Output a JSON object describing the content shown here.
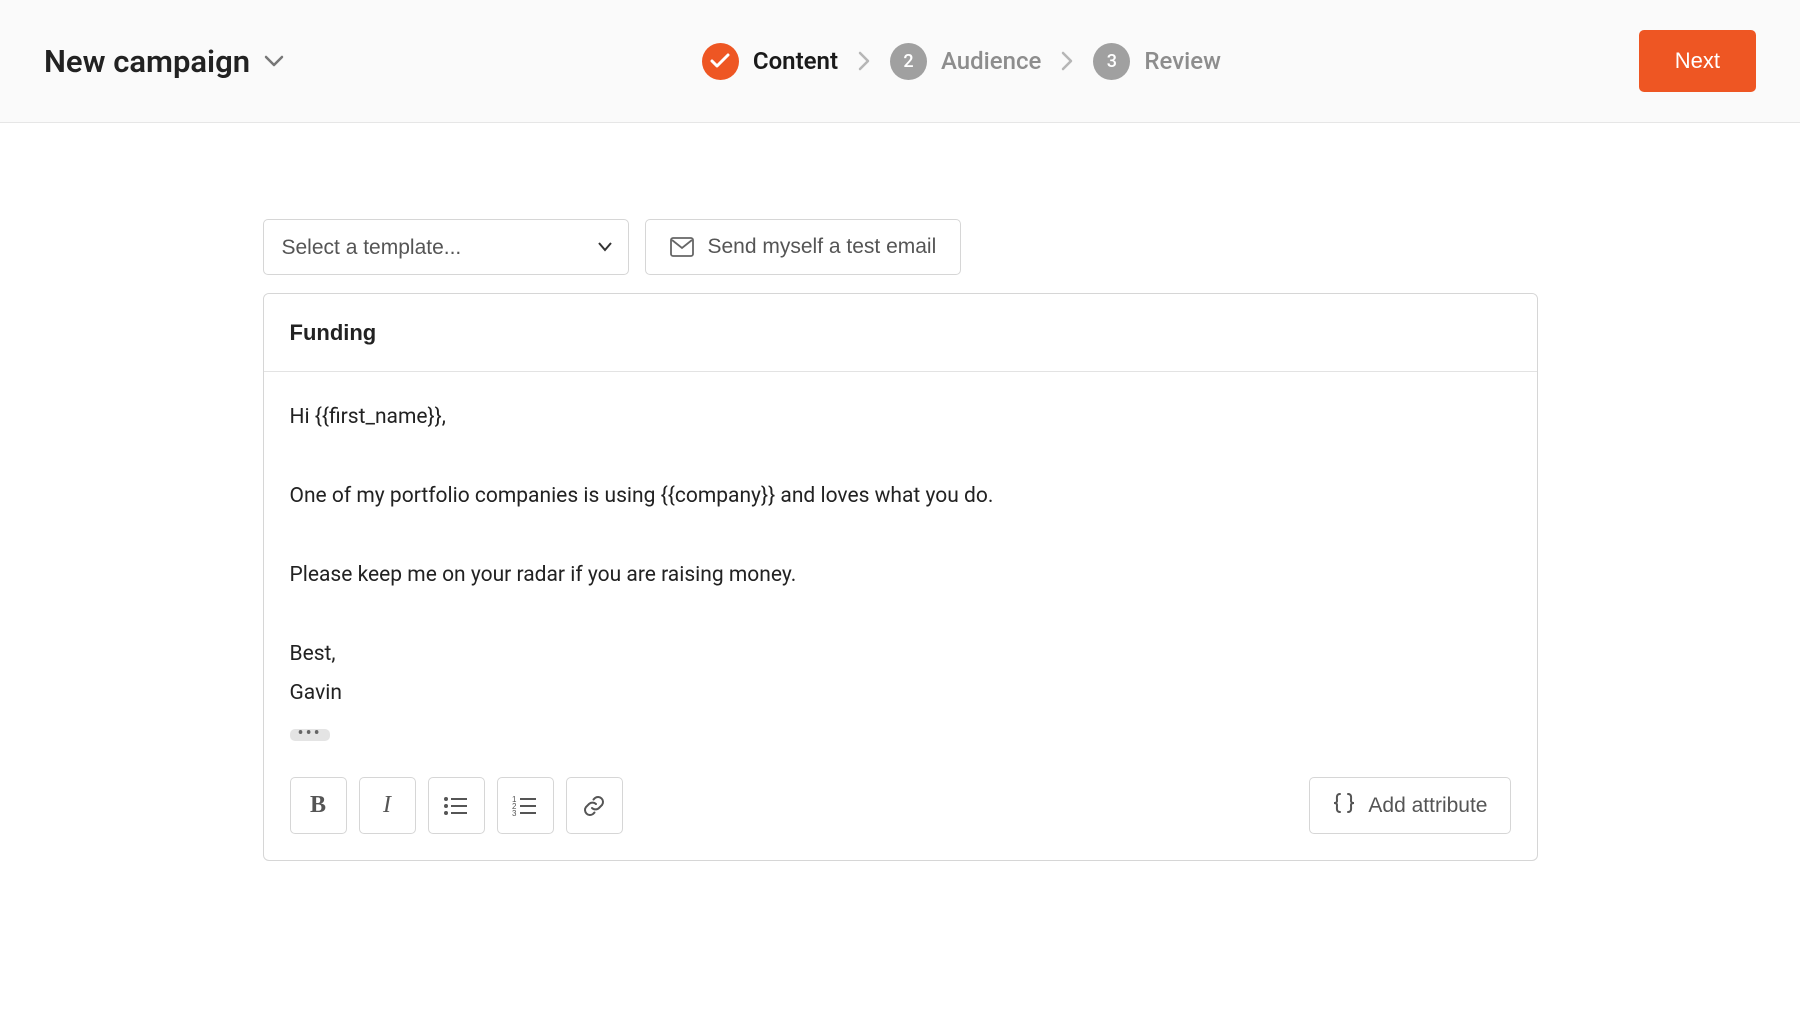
{
  "header": {
    "title": "New campaign",
    "steps": [
      {
        "label": "Content",
        "state": "active",
        "indicator": "check"
      },
      {
        "label": "Audience",
        "state": "inactive",
        "indicator": "2"
      },
      {
        "label": "Review",
        "state": "inactive",
        "indicator": "3"
      }
    ],
    "next_button": "Next"
  },
  "toolbar": {
    "template_select_placeholder": "Select a template...",
    "send_test_label": "Send myself a test email"
  },
  "editor": {
    "subject": "Funding",
    "body": "Hi {{first_name}},\n\nOne of my portfolio companies is using {{company}} and loves what you do.\n\nPlease keep me on your radar if you are raising money.\n\nBest,\nGavin",
    "format_buttons": {
      "bold": "B",
      "italic": "I"
    },
    "add_attribute_label": "Add attribute"
  },
  "colors": {
    "accent": "#ee5623",
    "muted": "#8d8d8d",
    "border": "#d6d6d6"
  }
}
